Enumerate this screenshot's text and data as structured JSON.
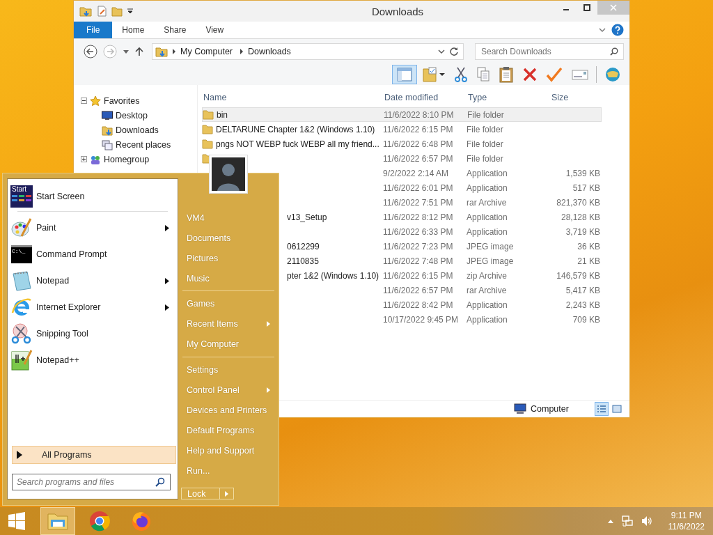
{
  "window": {
    "title": "Downloads"
  },
  "ribbon_tabs": [
    {
      "label": "File",
      "selected": true
    },
    {
      "label": "Home",
      "selected": false
    },
    {
      "label": "Share",
      "selected": false
    },
    {
      "label": "View",
      "selected": false
    }
  ],
  "address": {
    "crumbs": [
      "My Computer",
      "Downloads"
    ]
  },
  "search": {
    "placeholder": "Search Downloads"
  },
  "toolbar": [
    {
      "kind": "pane",
      "on": true
    },
    {
      "kind": "folder-check"
    },
    {
      "kind": "cut"
    },
    {
      "kind": "copy"
    },
    {
      "kind": "paste"
    },
    {
      "kind": "delete"
    },
    {
      "kind": "check"
    },
    {
      "kind": "card"
    },
    {
      "kind": "globe"
    }
  ],
  "nav": [
    {
      "label": "Favorites",
      "kind": "star",
      "expanded": true,
      "children": [
        {
          "label": "Desktop",
          "kind": "desktop"
        },
        {
          "label": "Downloads",
          "kind": "downloads"
        },
        {
          "label": "Recent places",
          "kind": "recent"
        }
      ]
    },
    {
      "label": "Homegroup",
      "kind": "homegroup",
      "expanded": false
    }
  ],
  "columns": [
    "Name",
    "Date modified",
    "Type",
    "Size"
  ],
  "files": [
    {
      "name": "bin",
      "kind": "folder",
      "date": "11/6/2022 8:10 PM",
      "type": "File folder",
      "selected": true
    },
    {
      "name": "DELTARUNE Chapter 1&2 (Windows 1.10)",
      "kind": "folder",
      "date": "11/6/2022 6:15 PM",
      "type": "File folder",
      "selected": false
    },
    {
      "name": "pngs NOT WEBP fuck WEBP all my friend...",
      "kind": "folder",
      "date": "11/6/2022 6:48 PM",
      "type": "File folder",
      "selected": false
    },
    {
      "kind": "folder",
      "date": "11/6/2022 6:57 PM",
      "type": "File folder",
      "selected": false
    },
    {
      "date": "9/2/2022 2:14 AM",
      "type": "Application",
      "size": "1,539 KB",
      "selected": false
    },
    {
      "date": "11/6/2022 6:01 PM",
      "type": "Application",
      "size": "517 KB",
      "selected": false
    },
    {
      "date": "11/6/2022 7:51 PM",
      "type": "rar Archive",
      "size": "821,370 KB",
      "selected": false
    },
    {
      "name": "v13_Setup",
      "date": "11/6/2022 8:12 PM",
      "type": "Application",
      "size": "28,128 KB",
      "selected": false
    },
    {
      "date": "11/6/2022 6:33 PM",
      "type": "Application",
      "size": "3,719 KB",
      "selected": false
    },
    {
      "name": "0612299",
      "date": "11/6/2022 7:23 PM",
      "type": "JPEG image",
      "size": "36 KB",
      "selected": false
    },
    {
      "name": "2110835",
      "date": "11/6/2022 7:48 PM",
      "type": "JPEG image",
      "size": "21 KB",
      "selected": false
    },
    {
      "name": "pter 1&2 (Windows 1.10)",
      "date": "11/6/2022 6:15 PM",
      "type": "zip Archive",
      "size": "146,579 KB",
      "selected": false
    },
    {
      "date": "11/6/2022 6:57 PM",
      "type": "rar Archive",
      "size": "5,417 KB",
      "selected": false
    },
    {
      "date": "11/6/2022 8:42 PM",
      "type": "Application",
      "size": "2,243 KB",
      "selected": false
    },
    {
      "date": "10/17/2022 9:45 PM",
      "type": "Application",
      "size": "709 KB",
      "selected": false
    }
  ],
  "status_bar": {
    "location": "Computer",
    "views": [
      {
        "kind": "details",
        "selected": true
      },
      {
        "kind": "tiles",
        "selected": false
      }
    ]
  },
  "start_menu": {
    "pinned": [
      {
        "label": "Start Screen",
        "kind": "start-screen",
        "icon_text": "Start",
        "submenu": false
      },
      {
        "label": "Paint",
        "kind": "paint",
        "submenu": true
      },
      {
        "label": "Command Prompt",
        "kind": "cmd",
        "icon_text": "C:\\_",
        "submenu": false
      },
      {
        "label": "Notepad",
        "kind": "notepad",
        "submenu": true
      },
      {
        "label": "Internet Explorer",
        "kind": "ie",
        "submenu": true
      },
      {
        "label": "Snipping Tool",
        "kind": "snip",
        "submenu": false
      },
      {
        "label": "Notepad++",
        "kind": "notepadpp",
        "submenu": false
      }
    ],
    "all_programs": {
      "label": "All Programs",
      "highlighted": true
    },
    "search": {
      "placeholder": "Search programs and files"
    },
    "places": [
      [
        {
          "label": "VM4",
          "submenu": false
        },
        {
          "label": "Documents",
          "submenu": false
        },
        {
          "label": "Pictures",
          "submenu": false
        },
        {
          "label": "Music",
          "submenu": false
        }
      ],
      [
        {
          "label": "Games",
          "submenu": false
        },
        {
          "label": "Recent Items",
          "submenu": true
        },
        {
          "label": "My Computer",
          "submenu": false
        }
      ],
      [
        {
          "label": "Settings",
          "submenu": false
        },
        {
          "label": "Control Panel",
          "submenu": true
        },
        {
          "label": "Devices and Printers",
          "submenu": false
        },
        {
          "label": "Default Programs",
          "submenu": false
        },
        {
          "label": "Help and Support",
          "submenu": false
        },
        {
          "label": "Run...",
          "submenu": false
        }
      ]
    ],
    "power": {
      "label": "Lock"
    }
  },
  "taskbar": {
    "apps": [
      {
        "kind": "explorer",
        "active": true
      },
      {
        "kind": "chrome",
        "active": false
      },
      {
        "kind": "firefox",
        "active": false
      }
    ],
    "time": "9:11 PM",
    "date": "11/6/2022"
  }
}
